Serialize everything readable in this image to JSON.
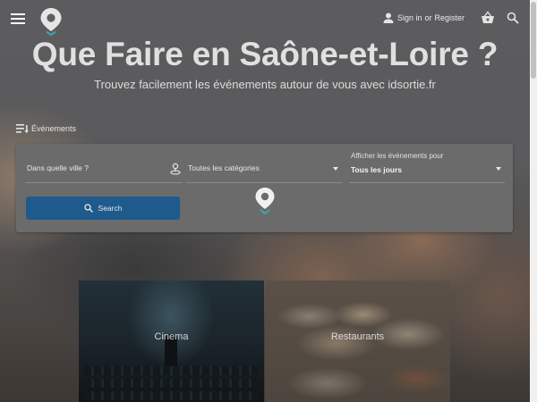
{
  "header": {
    "menu_icon": "hamburger-menu-icon",
    "logo_icon": "map-pin-logo-icon",
    "sign_in_label": "Sign in",
    "or_label": "or",
    "register_label": "Register",
    "basket_icon": "basket-icon",
    "search_icon": "search-icon"
  },
  "hero": {
    "title": "Que Faire en Saône-et-Loire ?",
    "subtitle": "Trouvez facilement les événements autour de vous avec idsortie.fr"
  },
  "events_section": {
    "label": "Événements",
    "icon": "filter-list-icon"
  },
  "search_form": {
    "city_placeholder": "Dans quelle ville ?",
    "category_placeholder": "Toutes les catégories",
    "period_label": "Afficher les événements pour",
    "period_value": "Tous les jours",
    "search_button_label": "Search"
  },
  "categories": [
    {
      "label": "Cinema"
    },
    {
      "label": "Restaurants"
    }
  ],
  "colors": {
    "accent_button": "#1e5a8c",
    "logo_teal": "#3aa8b0",
    "overlay": "#5a5a5c"
  }
}
